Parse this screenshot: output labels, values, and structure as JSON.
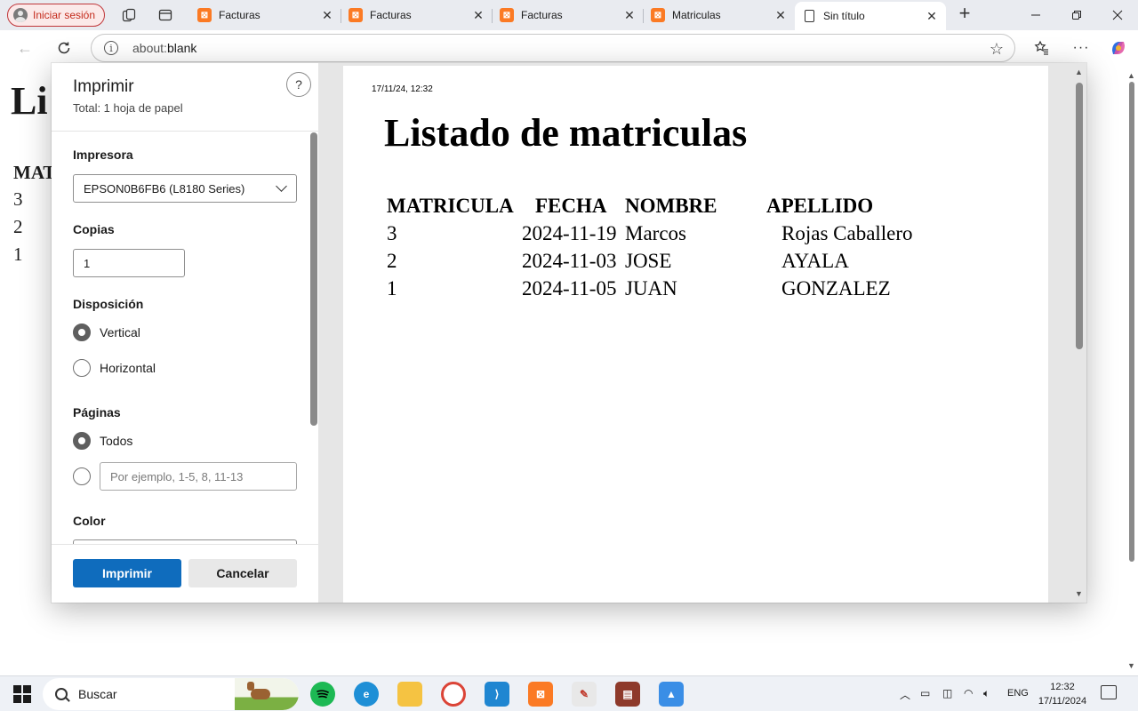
{
  "browser": {
    "profile_label": "Iniciar sesión",
    "tabs": [
      {
        "label": "Facturas"
      },
      {
        "label": "Facturas"
      },
      {
        "label": "Facturas"
      },
      {
        "label": "Matriculas"
      },
      {
        "label": "Sin título"
      }
    ],
    "new_tab_symbol": "+",
    "close_symbol": "✕",
    "url_prefix": "about:",
    "url_host": "blank"
  },
  "background_page": {
    "title": "Li",
    "header": "MAT",
    "rows": [
      "3",
      "2",
      "1"
    ]
  },
  "print_dialog": {
    "title": "Imprimir",
    "subtitle": "Total: 1 hoja de papel",
    "help": "?",
    "printer_label": "Impresora",
    "printer_value": "EPSON0B6FB6 (L8180 Series)",
    "copies_label": "Copias",
    "copies_value": "1",
    "layout_label": "Disposición",
    "layout_options": [
      "Vertical",
      "Horizontal"
    ],
    "layout_selected": "Vertical",
    "pages_label": "Páginas",
    "pages_all": "Todos",
    "pages_placeholder": "Por ejemplo, 1-5, 8, 11-13",
    "color_label": "Color",
    "print_button": "Imprimir",
    "cancel_button": "Cancelar"
  },
  "preview": {
    "date": "17/11/24, 12:32",
    "title": "Listado de matriculas",
    "headers": [
      "MATRICULA",
      "FECHA",
      "NOMBRE",
      "APELLIDO"
    ],
    "rows": [
      [
        "3",
        "2024-11-19",
        "Marcos",
        "Rojas Caballero"
      ],
      [
        "2",
        "2024-11-03",
        "JOSE",
        "AYALA"
      ],
      [
        "1",
        "2024-11-05",
        "JUAN",
        "GONZALEZ"
      ]
    ]
  },
  "taskbar": {
    "search_label": "Buscar",
    "language": "ENG",
    "time": "12:32",
    "date": "17/11/2024"
  },
  "colors": {
    "print_button": "#0f6cbd",
    "xampp_orange": "#fb7a24",
    "profile_red": "#c42b1c"
  },
  "icons": [
    "person-icon",
    "workspaces-icon",
    "tab-actions-icon",
    "xampp-icon",
    "document-icon",
    "back-icon",
    "refresh-icon",
    "info-icon",
    "star-icon",
    "favorites-icon",
    "more-icon",
    "copilot-icon",
    "minimize-icon",
    "restore-icon",
    "close-icon",
    "chevron-down-icon",
    "help-icon",
    "windows-start-icon",
    "search-icon"
  ]
}
